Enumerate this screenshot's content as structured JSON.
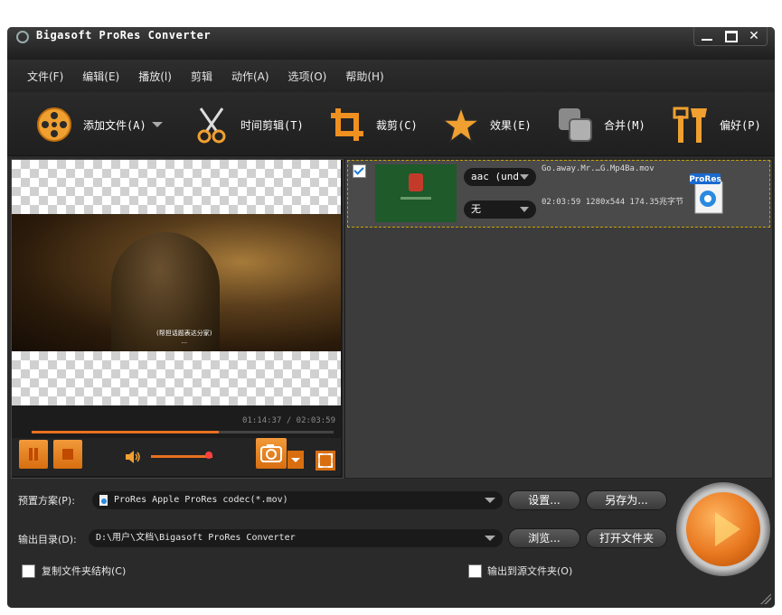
{
  "window": {
    "title": "Bigasoft ProRes Converter"
  },
  "menu": [
    "文件(F)",
    "编辑(E)",
    "播放(l)",
    "剪辑",
    "动作(A)",
    "选项(O)",
    "帮助(H)"
  ],
  "toolbar": {
    "add_file": "添加文件(A)",
    "trim": "时间剪辑(T)",
    "crop": "裁剪(C)",
    "effect": "效果(E)",
    "merge": "合并(M)",
    "preferences": "偏好(P)"
  },
  "preview": {
    "subtitle_line1": "(帮担话题表达分家)",
    "subtitle_line2": "...",
    "time_display": "01:14:37 / 02:03:59",
    "progress_fraction": 0.62,
    "volume_fraction": 0.9
  },
  "file": {
    "checked": true,
    "audio_track": "aac (und",
    "subtitle_track": "无",
    "name": "Go.away.Mr.…G.Mp4Ba.mov",
    "info": "02:03:59 1280x544 174.35兆字节",
    "format_badge": "ProRes"
  },
  "profile": {
    "label": "预置方案(P):",
    "value": "ProRes Apple ProRes codec(*.mov)",
    "settings_button": "设置...",
    "save_as_button": "另存为..."
  },
  "output": {
    "label": "输出目录(D):",
    "value": "D:\\用户\\文档\\Bigasoft ProRes Converter",
    "browse_button": "浏览...",
    "open_folder_button": "打开文件夹"
  },
  "options": {
    "copy_structure": "复制文件夹结构(C)",
    "output_to_source": "输出到源文件夹(O)"
  },
  "colors": {
    "accent": "#e87020",
    "background": "#2b2b2b"
  }
}
